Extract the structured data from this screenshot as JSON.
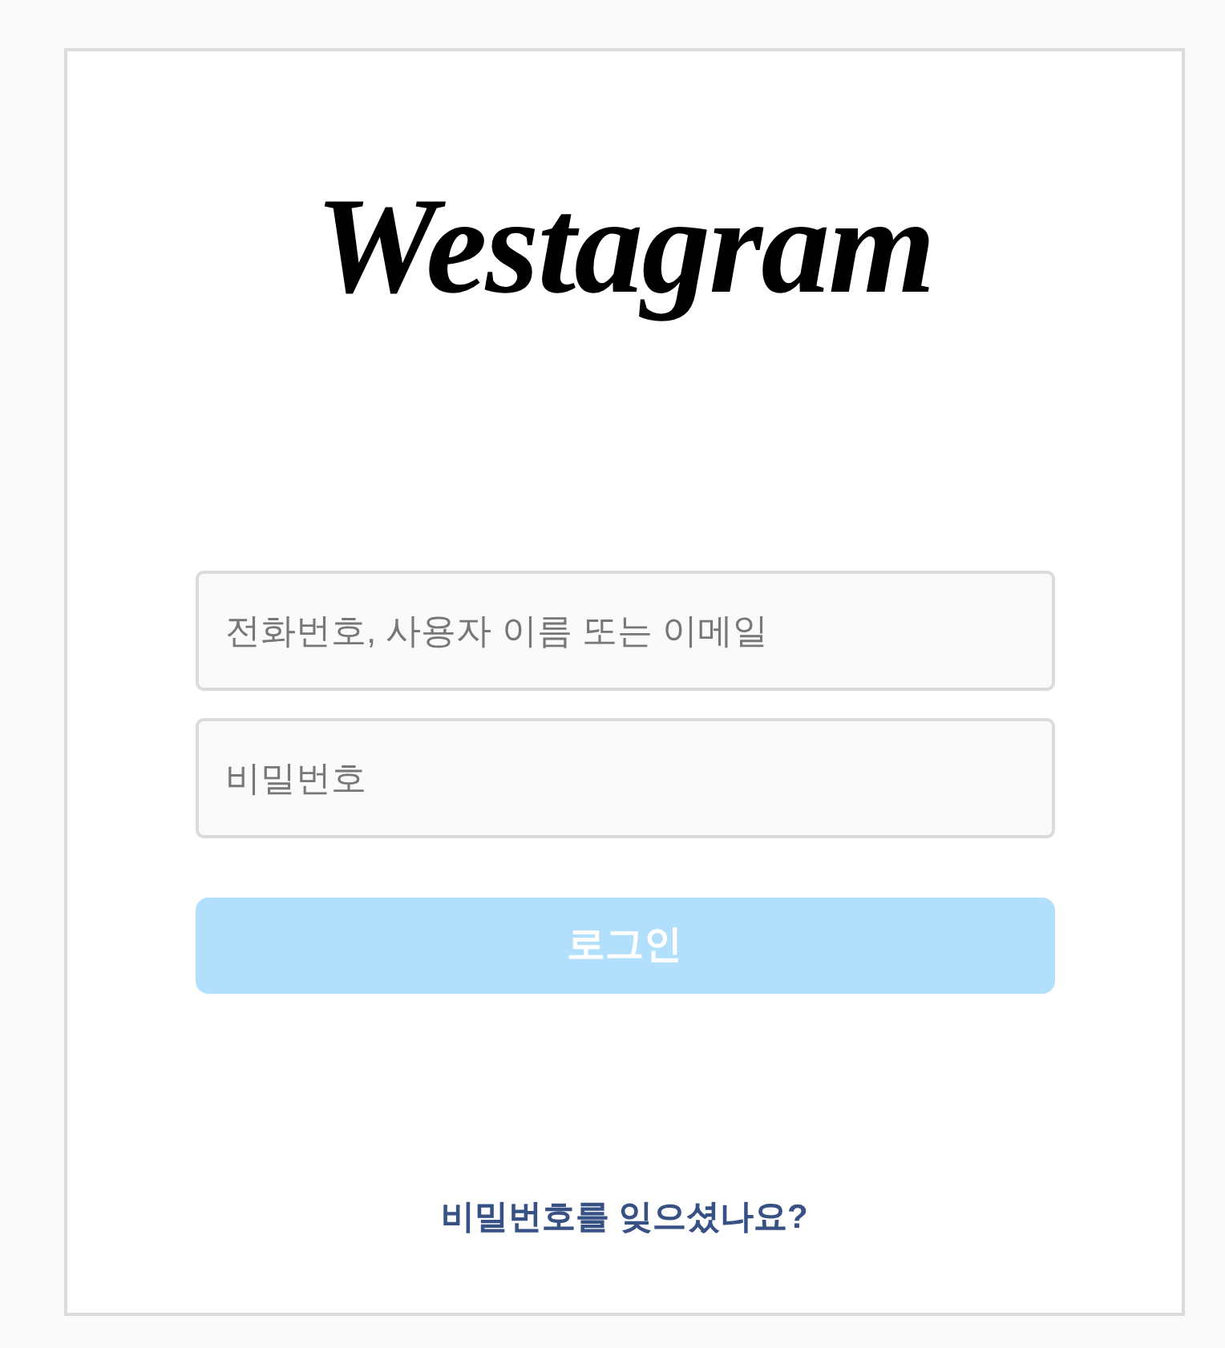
{
  "logo": "Westagram",
  "fields": [
    {
      "placeholder": "전화번호, 사용자 이름 또는 이메일"
    },
    {
      "placeholder": "비밀번호"
    }
  ],
  "login_button": {
    "label": "로그인",
    "disabled": true
  },
  "forgot_link": "비밀번호를 잊으셨나요?"
}
